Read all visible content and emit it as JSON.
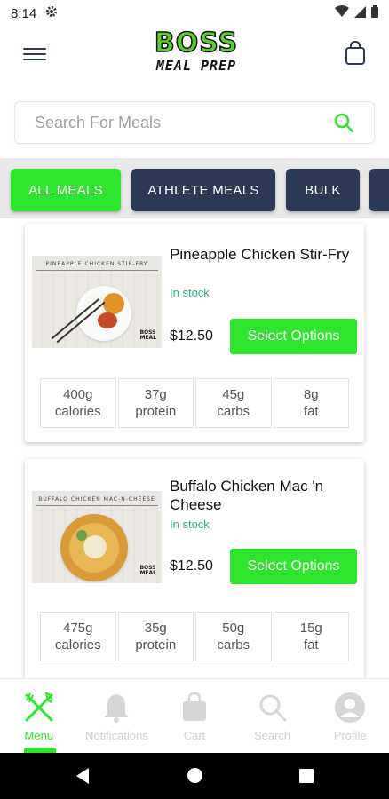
{
  "status": {
    "time": "8:14"
  },
  "header": {
    "logo_top": "BOSS",
    "logo_bottom": "MEAL PREP"
  },
  "search": {
    "placeholder": "Search For Meals"
  },
  "categories": [
    {
      "label": "ALL MEALS",
      "active": true
    },
    {
      "label": "ATHLETE MEALS",
      "active": false
    },
    {
      "label": "BULK",
      "active": false
    }
  ],
  "meals": [
    {
      "image_label": "PINEAPPLE CHICKEN STIR-FRY",
      "title": "Pineapple Chicken Stir-Fry",
      "stock": "In stock",
      "price": "$12.50",
      "button": "Select Options",
      "nutrition": [
        {
          "value": "400g",
          "unit": "calories"
        },
        {
          "value": "37g",
          "unit": "protein"
        },
        {
          "value": "45g",
          "unit": "carbs"
        },
        {
          "value": "8g",
          "unit": "fat"
        }
      ]
    },
    {
      "image_label": "BUFFALO CHICKEN MAC-N-CHEESE",
      "title": "Buffalo Chicken Mac 'n Cheese",
      "stock": "In stock",
      "price": "$12.50",
      "button": "Select Options",
      "nutrition": [
        {
          "value": "475g",
          "unit": "calories"
        },
        {
          "value": "35g",
          "unit": "protein"
        },
        {
          "value": "50g",
          "unit": "carbs"
        },
        {
          "value": "15g",
          "unit": "fat"
        }
      ]
    }
  ],
  "bottom_nav": [
    {
      "label": "Menu",
      "icon": "fork-knife-icon",
      "active": true
    },
    {
      "label": "Notifications",
      "icon": "bell-icon",
      "active": false
    },
    {
      "label": "Cart",
      "icon": "shopping-bag-icon",
      "active": false
    },
    {
      "label": "Search",
      "icon": "search-icon",
      "active": false
    },
    {
      "label": "Profile",
      "icon": "profile-icon",
      "active": false
    }
  ],
  "colors": {
    "accent": "#2ee52e",
    "navy": "#2b3856",
    "stock": "#2fb37a"
  }
}
